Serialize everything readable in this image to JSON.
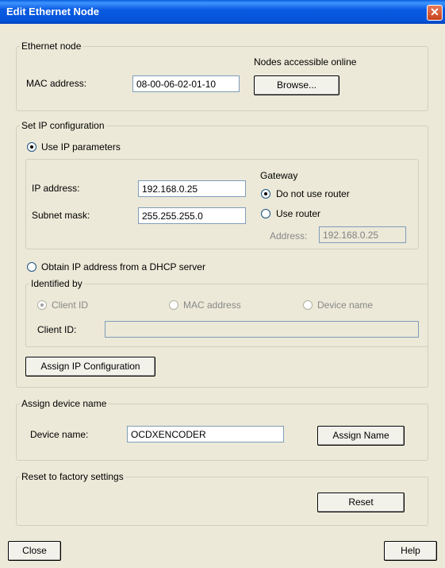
{
  "window": {
    "title": "Edit Ethernet Node",
    "close_glyph": "✕"
  },
  "ethernet_node": {
    "legend": "Ethernet node",
    "online_label": "Nodes accessible online",
    "mac_label": "MAC address:",
    "mac_value": "08-00-06-02-01-10",
    "browse_label": "Browse..."
  },
  "ip_config": {
    "legend": "Set IP configuration",
    "use_ip_label": "Use IP parameters",
    "ip_label": "IP address:",
    "ip_value": "192.168.0.25",
    "subnet_label": "Subnet mask:",
    "subnet_value": "255.255.255.0",
    "gateway_label": "Gateway",
    "no_router_label": "Do not use router",
    "use_router_label": "Use router",
    "router_address_label": "Address:",
    "router_address_value": "192.168.0.25",
    "dhcp_label": "Obtain IP address from a DHCP server",
    "identified_legend": "Identified by",
    "client_id_radio": "Client ID",
    "mac_radio": "MAC address",
    "device_name_radio": "Device name",
    "client_id_label": "Client ID:",
    "client_id_value": "",
    "assign_button": "Assign IP Configuration"
  },
  "device_name": {
    "legend": "Assign device name",
    "label": "Device name:",
    "value": "OCDXENCODER",
    "assign_button": "Assign Name"
  },
  "factory": {
    "legend": "Reset to factory settings",
    "reset_button": "Reset"
  },
  "footer": {
    "close_button": "Close",
    "help_button": "Help"
  }
}
